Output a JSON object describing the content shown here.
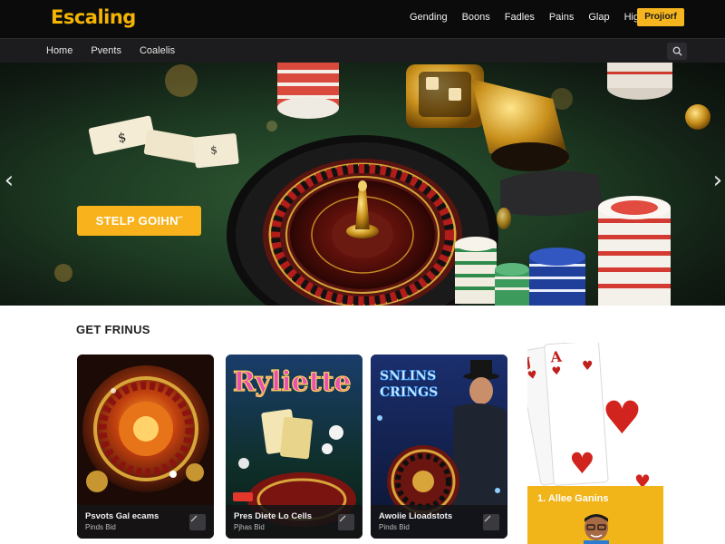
{
  "brand": {
    "logo": "Escaling",
    "accent": "#f5b51f"
  },
  "topnav": {
    "items": [
      "Gending",
      "Boons",
      "Fadles",
      "Pains",
      "Glap",
      "Hig"
    ],
    "cta_label": "Projiorf"
  },
  "subnav": {
    "items": [
      "Home",
      "Pvents",
      "Coalelis"
    ],
    "search_icon": "search-icon"
  },
  "hero": {
    "cta_label": "STELP GOIHN˝",
    "prev_arrow": "‹",
    "next_arrow": "›"
  },
  "section": {
    "title": "GET FRINUS"
  },
  "cards": [
    {
      "title": "Psvots Gal ecams",
      "subtitle": "Pinds Bid"
    },
    {
      "title": "Pres Diete Lo Cells",
      "subtitle": "Pjhas Bid"
    },
    {
      "title": "Awoiie Lioadstots",
      "subtitle": "Pinds Bid"
    }
  ],
  "card_art": {
    "card2_banner": "Ryliette",
    "card3_banner_line1": "SNLINS",
    "card3_banner_line2": "CRINGS"
  },
  "promo": {
    "title": "1. Allee Ganins"
  }
}
